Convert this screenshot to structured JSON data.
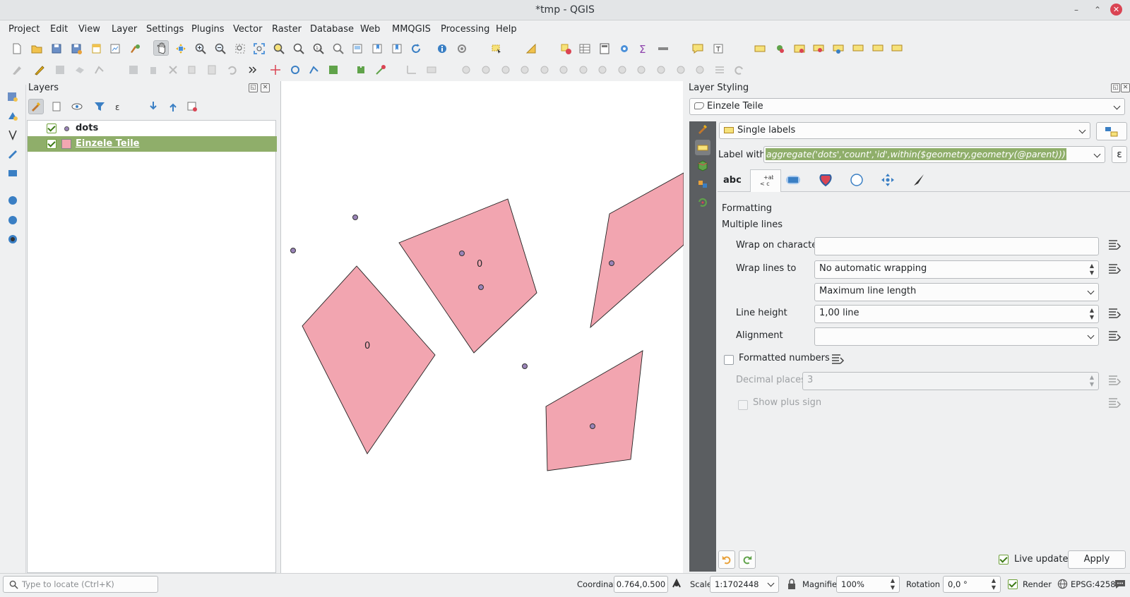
{
  "window": {
    "title": "*tmp - QGIS",
    "min_glyph": "–",
    "max_glyph": "⌃",
    "close_glyph": "✕"
  },
  "menubar": [
    "Project",
    "Edit",
    "View",
    "Layer",
    "Settings",
    "Plugins",
    "Vector",
    "Raster",
    "Database",
    "Web",
    "MMQGIS",
    "Processing",
    "Help"
  ],
  "layers_panel": {
    "title": "Layers",
    "layers": [
      {
        "name": "dots",
        "visible": true,
        "symbol": "point",
        "color": "#9a84b8"
      },
      {
        "name": "Einzele Teile",
        "visible": true,
        "symbol": "polygon",
        "color": "#f2a7b1",
        "selected": true
      }
    ]
  },
  "map": {
    "polygon_fill": "#f2a5b0",
    "point_fill": "#9a84b8",
    "labels": [
      "0",
      "0"
    ]
  },
  "styling_panel": {
    "title": "Layer Styling",
    "layer": "Einzele Teile",
    "mode": "Single labels",
    "label_with_label": "Label with",
    "expression": "aggregate('dots','count','id',within($geometry,geometry(@parent)))",
    "tab_abc": "abc",
    "section_formatting": "Formatting",
    "section_multiple_lines": "Multiple lines",
    "wrap_on_char_label": "Wrap on character",
    "wrap_on_char_value": "",
    "wrap_lines_to_label": "Wrap lines to",
    "wrap_lines_to_value": "No automatic wrapping",
    "max_line_length": "Maximum line length",
    "line_height_label": "Line height",
    "line_height_value": "1,00 line",
    "alignment_label": "Alignment",
    "alignment_value": "",
    "formatted_numbers_label": "Formatted numbers",
    "formatted_numbers_checked": false,
    "decimal_places_label": "Decimal places",
    "decimal_places_value": "3",
    "show_plus_sign_label": "Show plus sign",
    "live_update_label": "Live update",
    "live_update_checked": true,
    "apply_label": "Apply",
    "epsilon_glyph": "ε"
  },
  "statusbar": {
    "locate_placeholder": "Type to locate (Ctrl+K)",
    "coordinate_label": "Coordinate",
    "coordinate_value": "0.764,0.500",
    "scale_label": "Scale",
    "scale_value": "1:1702448",
    "magnifier_label": "Magnifier",
    "magnifier_value": "100%",
    "rotation_label": "Rotation",
    "rotation_value": "0,0 °",
    "render_label": "Render",
    "render_checked": true,
    "crs": "EPSG:4258"
  }
}
